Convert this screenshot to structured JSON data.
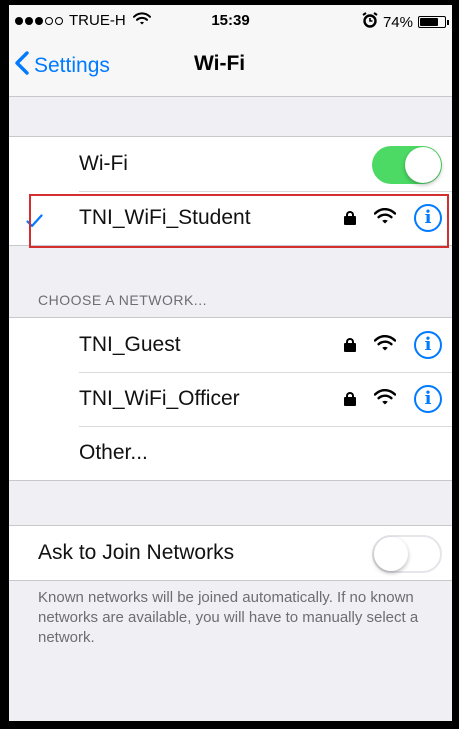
{
  "status_bar": {
    "carrier": "TRUE-H",
    "time": "15:39",
    "battery_percent": "74%",
    "battery_level": 0.74,
    "signal_filled": 3,
    "signal_total": 5,
    "icons": [
      "wifi-icon",
      "alarm-icon",
      "battery-icon"
    ]
  },
  "nav": {
    "back_label": "Settings",
    "title": "Wi-Fi"
  },
  "wifi_toggle": {
    "label": "Wi-Fi",
    "state": "on"
  },
  "connected_network": {
    "name": "TNI_WiFi_Student",
    "secured": true,
    "checked": true
  },
  "networks_section": {
    "header": "CHOOSE A NETWORK...",
    "items": [
      {
        "name": "TNI_Guest",
        "secured": true
      },
      {
        "name": "TNI_WiFi_Officer",
        "secured": true
      }
    ],
    "other_label": "Other..."
  },
  "ask_to_join": {
    "label": "Ask to Join Networks",
    "state": "off",
    "footer": "Known networks will be joined automatically. If no known networks are available, you will have to manually select a network."
  },
  "colors": {
    "accent": "#007aff",
    "toggle_on": "#4cd964",
    "highlight": "#d32f2f",
    "background": "#efeff4"
  }
}
